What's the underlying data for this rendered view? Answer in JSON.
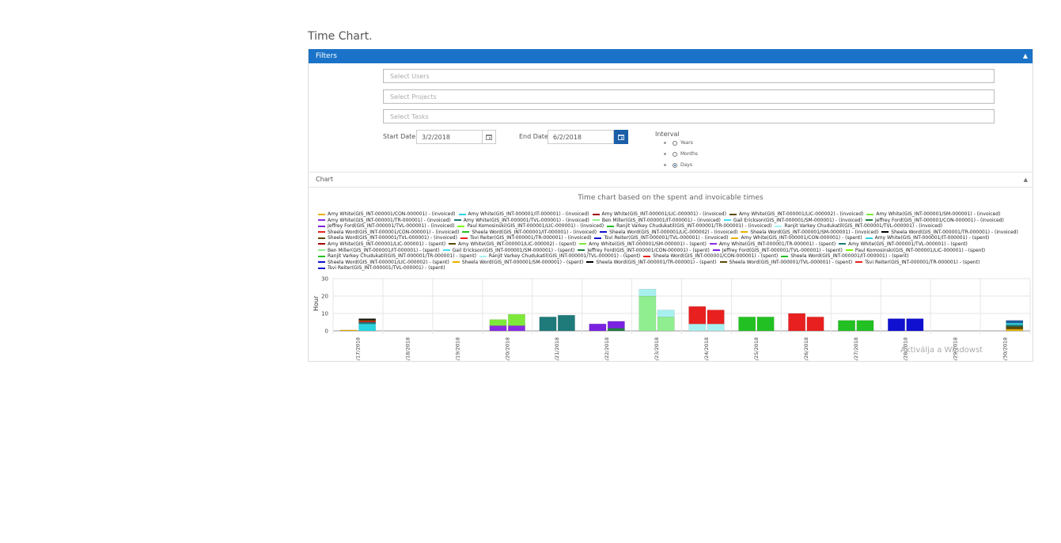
{
  "page": {
    "title": "Time Chart."
  },
  "filters": {
    "header": "Filters",
    "users_placeholder": "Select Users",
    "projects_placeholder": "Select Projects",
    "tasks_placeholder": "Select Tasks",
    "start_label": "Start Date",
    "start_value": "3/2/2018",
    "end_label": "End Date",
    "end_value": "6/2/2018",
    "interval_label": "Interval",
    "interval_options": [
      "Years",
      "Months",
      "Days"
    ],
    "interval_selected": "Days"
  },
  "chart_panel": {
    "header": "Chart"
  },
  "watermark": "Aktiválja a Windowst",
  "chart_data": {
    "type": "bar",
    "title": "Time chart based on the spent and invoicable times",
    "ylabel": "Hour",
    "xlabel": "",
    "ylim": [
      0,
      30
    ],
    "yticks": [
      0,
      10,
      20,
      30
    ],
    "categories": [
      "5/17/2018",
      "5/18/2018",
      "5/19/2018",
      "5/20/2018",
      "5/21/2018",
      "5/22/2018",
      "5/23/2018",
      "5/24/2018",
      "5/25/2018",
      "5/26/2018",
      "5/27/2018",
      "5/28/2018",
      "5/29/2018",
      "5/30/2018"
    ],
    "legend": [
      {
        "label": "Amy White(GIS_INT-000001/CON-000001) - (invoiced)",
        "color": "#e8b000"
      },
      {
        "label": "Amy White(GIS_INT-000001/IT-000001) - (invoiced)",
        "color": "#2ad4e0"
      },
      {
        "label": "Amy White(GIS_INT-000001/LIC-000001) - (invoiced)",
        "color": "#a00000"
      },
      {
        "label": "Amy White(GIS_INT-000001/LIC-000002) - (invoiced)",
        "color": "#5a4a00"
      },
      {
        "label": "Amy White(GIS_INT-000001/SM-000001) - (invoiced)",
        "color": "#7ee83a"
      },
      {
        "label": "Amy White(GIS_INT-000001/TR-000001) - (invoiced)",
        "color": "#8a2be2"
      },
      {
        "label": "Amy White(GIS_INT-000001/TVL-000001) - (invoiced)",
        "color": "#1f7a7a"
      },
      {
        "label": "Ben Miller(GIS_INT-000001/IT-000001) - (invoiced)",
        "color": "#90ee90"
      },
      {
        "label": "Gail Erickson(GIS_INT-000001/SM-000001) - (invoiced)",
        "color": "#40e0f0"
      },
      {
        "label": "Jeffrey Ford(GIS_INT-000001/CON-000001) - (invoiced)",
        "color": "#1e7f3f"
      },
      {
        "label": "Jeffrey Ford(GIS_INT-000001/TVL-000001) - (invoiced)",
        "color": "#7b22e0"
      },
      {
        "label": "Paul Komosinski(GIS_INT-000001/LIC-000001) - (invoiced)",
        "color": "#7cfc00"
      },
      {
        "label": "Ranjit Varkey Chudukatil(GIS_INT-000001/TR-000001) - (invoiced)",
        "color": "#22c022"
      },
      {
        "label": "Ranjit Varkey Chudukatil(GIS_INT-000001/TVL-000001) - (invoiced)",
        "color": "#a8f0f0"
      },
      {
        "label": "Sheela Word(GIS_INT-000001/CON-000001) - (invoiced)",
        "color": "#e82020"
      },
      {
        "label": "Sheela Word(GIS_INT-000001/IT-000001) - (invoiced)",
        "color": "#22c022"
      },
      {
        "label": "Sheela Word(GIS_INT-000001/LIC-000002) - (invoiced)",
        "color": "#1010d0"
      },
      {
        "label": "Sheela Word(GIS_INT-000001/SM-000001) - (invoiced)",
        "color": "#e8b000"
      },
      {
        "label": "Sheela Word(GIS_INT-000001/TR-000001) - (invoiced)",
        "color": "#000000"
      },
      {
        "label": "Sheela Word(GIS_INT-000001/TVL-000001) - (invoiced)",
        "color": "#5a4a00"
      },
      {
        "label": "Tsvi Reiter(GIS_INT-000001/TR-000001) - (invoiced)",
        "color": "#e82020"
      },
      {
        "label": "Tsvi Reiter(GIS_INT-000001/TVL-000001) - (invoiced)",
        "color": "#1010d0"
      },
      {
        "label": "Amy White(GIS_INT-000001/CON-000001) - (spent)",
        "color": "#e8b000"
      },
      {
        "label": "Amy White(GIS_INT-000001/IT-000001) - (spent)",
        "color": "#2ad4e0"
      },
      {
        "label": "Amy White(GIS_INT-000001/LIC-000001) - (spent)",
        "color": "#a00000"
      },
      {
        "label": "Amy White(GIS_INT-000001/LIC-000002) - (spent)",
        "color": "#5a4a00"
      },
      {
        "label": "Amy White(GIS_INT-000001/SM-000001) - (spent)",
        "color": "#7ee83a"
      },
      {
        "label": "Amy White(GIS_INT-000001/TR-000001) - (spent)",
        "color": "#8a2be2"
      },
      {
        "label": "Amy White(GIS_INT-000001/TVL-000001) - (spent)",
        "color": "#1f7a7a"
      },
      {
        "label": "Ben Miller(GIS_INT-000001/IT-000001) - (spent)",
        "color": "#90ee90"
      },
      {
        "label": "Gail Erickson(GIS_INT-000001/SM-000001) - (spent)",
        "color": "#40e0f0"
      },
      {
        "label": "Jeffrey Ford(GIS_INT-000001/CON-000001) - (spent)",
        "color": "#1e7f3f"
      },
      {
        "label": "Jeffrey Ford(GIS_INT-000001/TVL-000001) - (spent)",
        "color": "#7b22e0"
      },
      {
        "label": "Paul Komosinski(GIS_INT-000001/LIC-000001) - (spent)",
        "color": "#7cfc00"
      },
      {
        "label": "Ranjit Varkey Chudukatil(GIS_INT-000001/TR-000001) - (spent)",
        "color": "#22c022"
      },
      {
        "label": "Ranjit Varkey Chudukatil(GIS_INT-000001/TVL-000001) - (spent)",
        "color": "#a8f0f0"
      },
      {
        "label": "Sheela Word(GIS_INT-000001/CON-000001) - (spent)",
        "color": "#e82020"
      },
      {
        "label": "Sheela Word(GIS_INT-000001/IT-000001) - (spent)",
        "color": "#22c022"
      },
      {
        "label": "Sheela Word(GIS_INT-000001/LIC-000002) - (spent)",
        "color": "#1010d0"
      },
      {
        "label": "Sheela Word(GIS_INT-000001/SM-000001) - (spent)",
        "color": "#e8b000"
      },
      {
        "label": "Sheela Word(GIS_INT-000001/TR-000001) - (spent)",
        "color": "#000000"
      },
      {
        "label": "Sheela Word(GIS_INT-000001/TVL-000001) - (spent)",
        "color": "#5a4a00"
      },
      {
        "label": "Tsvi Reiter(GIS_INT-000001/TR-000001) - (spent)",
        "color": "#e82020"
      },
      {
        "label": "Tsvi Reiter(GIS_INT-000001/TVL-000001) - (spent)",
        "color": "#1010d0"
      }
    ],
    "stacks": [
      {
        "x": "5/17/2018",
        "kind": "invoiced",
        "segments": [
          {
            "value": 0.5,
            "color": "#e8b000"
          }
        ]
      },
      {
        "x": "5/17/2018",
        "kind": "spent",
        "segments": [
          {
            "value": 4,
            "color": "#2ad4e0"
          },
          {
            "value": 1,
            "color": "#1f7a7a"
          },
          {
            "value": 0.7,
            "color": "#e82020"
          },
          {
            "value": 0.7,
            "color": "#5a4a00"
          },
          {
            "value": 0.6,
            "color": "#000000"
          }
        ]
      },
      {
        "x": "5/20/2018",
        "kind": "invoiced",
        "segments": [
          {
            "value": 3,
            "color": "#8a2be2"
          },
          {
            "value": 3.5,
            "color": "#7ee83a"
          }
        ]
      },
      {
        "x": "5/20/2018",
        "kind": "spent",
        "segments": [
          {
            "value": 3,
            "color": "#8a2be2"
          },
          {
            "value": 6.5,
            "color": "#7ee83a"
          }
        ]
      },
      {
        "x": "5/21/2018",
        "kind": "invoiced",
        "segments": [
          {
            "value": 8,
            "color": "#1f7a7a"
          }
        ]
      },
      {
        "x": "5/21/2018",
        "kind": "spent",
        "segments": [
          {
            "value": 9,
            "color": "#1f7a7a"
          }
        ]
      },
      {
        "x": "5/22/2018",
        "kind": "invoiced",
        "segments": [
          {
            "value": 4,
            "color": "#7b22e0"
          }
        ]
      },
      {
        "x": "5/22/2018",
        "kind": "spent",
        "segments": [
          {
            "value": 1.5,
            "color": "#1e7f3f"
          },
          {
            "value": 4,
            "color": "#7b22e0"
          }
        ]
      },
      {
        "x": "5/23/2018",
        "kind": "invoiced",
        "segments": [
          {
            "value": 20,
            "color": "#90ee90"
          },
          {
            "value": 4,
            "color": "#a8f0f0"
          }
        ]
      },
      {
        "x": "5/23/2018",
        "kind": "spent",
        "segments": [
          {
            "value": 8,
            "color": "#90ee90"
          },
          {
            "value": 4,
            "color": "#a8f0f0"
          }
        ]
      },
      {
        "x": "5/24/2018",
        "kind": "invoiced",
        "segments": [
          {
            "value": 4,
            "color": "#a8f0f0"
          },
          {
            "value": 10,
            "color": "#e82020"
          }
        ]
      },
      {
        "x": "5/24/2018",
        "kind": "spent",
        "segments": [
          {
            "value": 4,
            "color": "#a8f0f0"
          },
          {
            "value": 8,
            "color": "#e82020"
          }
        ]
      },
      {
        "x": "5/25/2018",
        "kind": "invoiced",
        "segments": [
          {
            "value": 8,
            "color": "#22c022"
          }
        ]
      },
      {
        "x": "5/25/2018",
        "kind": "spent",
        "segments": [
          {
            "value": 8,
            "color": "#22c022"
          }
        ]
      },
      {
        "x": "5/26/2018",
        "kind": "invoiced",
        "segments": [
          {
            "value": 10,
            "color": "#e82020"
          }
        ]
      },
      {
        "x": "5/26/2018",
        "kind": "spent",
        "segments": [
          {
            "value": 8,
            "color": "#e82020"
          }
        ]
      },
      {
        "x": "5/27/2018",
        "kind": "invoiced",
        "segments": [
          {
            "value": 6,
            "color": "#22c022"
          }
        ]
      },
      {
        "x": "5/27/2018",
        "kind": "spent",
        "segments": [
          {
            "value": 6,
            "color": "#22c022"
          }
        ]
      },
      {
        "x": "5/28/2018",
        "kind": "invoiced",
        "segments": [
          {
            "value": 7,
            "color": "#1010d0"
          }
        ]
      },
      {
        "x": "5/28/2018",
        "kind": "spent",
        "segments": [
          {
            "value": 7,
            "color": "#1010d0"
          }
        ]
      },
      {
        "x": "5/30/2018",
        "kind": "spent",
        "segments": [
          {
            "value": 1,
            "color": "#e8b000"
          },
          {
            "value": 1.5,
            "color": "#5a4a00"
          },
          {
            "value": 1,
            "color": "#1f7a7a"
          },
          {
            "value": 1,
            "color": "#2ad4e0"
          },
          {
            "value": 1.5,
            "color": "#1f5fa0"
          }
        ]
      }
    ]
  }
}
